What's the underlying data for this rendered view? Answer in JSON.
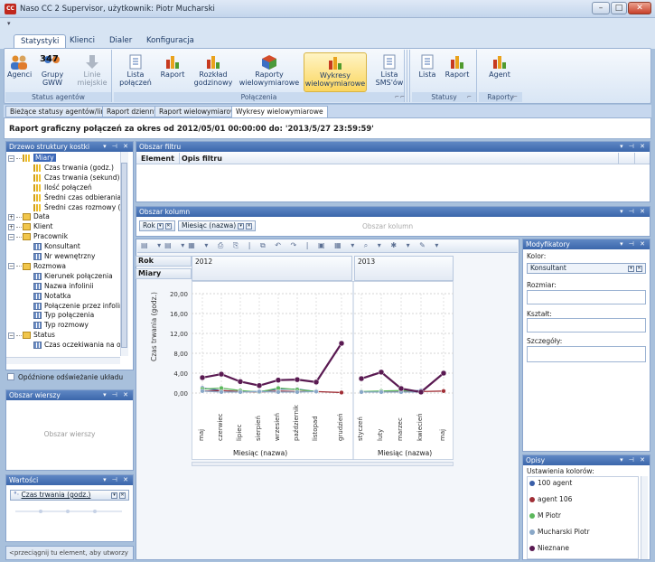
{
  "window": {
    "title": "Naso CC 2 Supervisor, użytkownik: Piotr Mucharski",
    "icon_label": "CC"
  },
  "ribbon_tabs": [
    "Statystyki",
    "Klienci",
    "Dialer",
    "Konfiguracja"
  ],
  "ribbon": {
    "groups": [
      {
        "label": "Status agentów",
        "buttons": [
          "Agenci",
          "Grupy GWW",
          "Linie miejskie"
        ]
      },
      {
        "label": "Połączenia",
        "buttons": [
          "Lista połączeń",
          "Raport",
          "Rozkład godzinowy",
          "Raporty wielowymiarowe",
          "Wykresy wielowymiarowe"
        ]
      },
      {
        "label": "",
        "buttons": [
          "Lista SMS'ów"
        ]
      },
      {
        "label": "Statusy",
        "buttons": [
          "Lista",
          "Raport"
        ]
      },
      {
        "label": "Raporty",
        "buttons": [
          "Agent"
        ]
      }
    ],
    "badge_value": "347"
  },
  "doc_tabs": [
    "Bieżące statusy agentów/linii",
    "Raport dzienny",
    "Raport wielowymiarowe",
    "Wykresy wielowymiarowe"
  ],
  "report_title": "Raport graficzny połączeń za okres od 2012/05/01 00:00:00 do: '2013/5/27 23:59:59'",
  "tree_pane": {
    "title": "Drzewo struktury kostki",
    "items": [
      {
        "label": "Miary",
        "level": 0,
        "icon": "measures-icon",
        "expanded": true,
        "selected": true
      },
      {
        "label": "Czas trwania (godz.)",
        "level": 2,
        "icon": "measure-icon"
      },
      {
        "label": "Czas trwania (sekund)",
        "level": 2,
        "icon": "measure-icon"
      },
      {
        "label": "Ilość połączeń",
        "level": 2,
        "icon": "measure-icon"
      },
      {
        "label": "Średni czas odbierania",
        "level": 2,
        "icon": "measure-icon"
      },
      {
        "label": "Średni czas rozmowy (se",
        "level": 2,
        "icon": "measure-icon"
      },
      {
        "label": "Data",
        "level": 0,
        "icon": "dimension-icon",
        "expanded": false
      },
      {
        "label": "Klient",
        "level": 0,
        "icon": "dimension-icon",
        "expanded": false
      },
      {
        "label": "Pracownik",
        "level": 0,
        "icon": "dimension-icon",
        "expanded": true
      },
      {
        "label": "Konsultant",
        "level": 2,
        "icon": "attribute-icon"
      },
      {
        "label": "Nr wewnętrzny",
        "level": 2,
        "icon": "attribute-icon"
      },
      {
        "label": "Rozmowa",
        "level": 0,
        "icon": "dimension-icon",
        "expanded": true
      },
      {
        "label": "Kierunek połączenia",
        "level": 2,
        "icon": "attribute-icon"
      },
      {
        "label": "Nazwa infolinii",
        "level": 2,
        "icon": "attribute-icon"
      },
      {
        "label": "Notatka",
        "level": 2,
        "icon": "attribute-icon"
      },
      {
        "label": "Połączenie przez infolin",
        "level": 2,
        "icon": "attribute-icon"
      },
      {
        "label": "Typ połączenia",
        "level": 2,
        "icon": "attribute-icon"
      },
      {
        "label": "Typ rozmowy",
        "level": 2,
        "icon": "attribute-icon"
      },
      {
        "label": "Status",
        "level": 0,
        "icon": "dimension-icon",
        "expanded": true
      },
      {
        "label": "Czas oczekiwania na oc",
        "level": 2,
        "icon": "attribute-icon"
      }
    ],
    "deferred_update": "Opóźnione odświeżanie układu"
  },
  "rows_pane": {
    "title": "Obszar wierszy",
    "placeholder": "Obszar wierszy"
  },
  "values_pane": {
    "title": "Wartości",
    "field": "Czas trwania (godz.)"
  },
  "drag_hint": "<przeciągnij tu element, aby utworzy",
  "filter_pane": {
    "title": "Obszar filtru",
    "col_element": "Element",
    "col_desc": "Opis filtru"
  },
  "columns_pane": {
    "title": "Obszar kolumn",
    "chips": [
      "Rok",
      "Miesiąc (nazwa)"
    ],
    "placeholder": "Obszar kolumn"
  },
  "chart_area": {
    "row_headers": [
      "Rok",
      "Miary"
    ],
    "years": [
      "2012",
      "2013"
    ],
    "ylabel": "Czas trwania (godz.)",
    "xlabel_groups": [
      "Miesiąc (nazwa)",
      "Miesiąc (nazwa)"
    ]
  },
  "chart_data": {
    "type": "line",
    "categories": [
      "maj",
      "czerwiec",
      "lipiec",
      "sierpień",
      "wrzesień",
      "październik",
      "listopad",
      "grudzień",
      "styczeń",
      "luty",
      "marzec",
      "kwiecień",
      "maj"
    ],
    "year_groups": [
      {
        "year": "2012",
        "count": 8
      },
      {
        "year": "2013",
        "count": 5
      }
    ],
    "ylabel": "Czas trwania (godz.)",
    "xlabel": "Miesiąc (nazwa)",
    "ylim": [
      0,
      22
    ],
    "yticks": [
      "0,00",
      "4,00",
      "8,00",
      "12,00",
      "16,00",
      "20,00"
    ],
    "series": [
      {
        "name": "100 agent",
        "color": "#3a5fa8",
        "values": [
          1.0,
          0.5,
          0.3,
          0.3,
          0.8,
          0.8,
          0.3,
          null,
          0.2,
          0.3,
          0.4,
          0.5,
          null
        ]
      },
      {
        "name": "agent 106",
        "color": "#a02e36",
        "values": [
          0.4,
          0.5,
          0.3,
          0.2,
          0.4,
          0.3,
          0.3,
          0.1,
          0.2,
          0.3,
          0.2,
          0.3,
          0.4
        ]
      },
      {
        "name": "M Piotr",
        "color": "#5cb85c",
        "values": [
          0.8,
          1.0,
          0.5,
          0.2,
          1.0,
          0.7,
          0.3,
          null,
          0.3,
          0.4,
          0.5,
          0.3,
          null
        ]
      },
      {
        "name": "Mucharski Piotr",
        "color": "#8aa8c8",
        "values": [
          0.4,
          0.2,
          0.2,
          0.3,
          0.2,
          0.2,
          0.3,
          null,
          0.2,
          0.2,
          0.2,
          0.2,
          null
        ]
      },
      {
        "name": "Nieznane",
        "color": "#5a1a52",
        "values": [
          3.1,
          3.8,
          2.3,
          1.5,
          2.6,
          2.7,
          2.2,
          10.0,
          2.9,
          4.2,
          0.9,
          0.2,
          4.0
        ]
      }
    ],
    "legend_title": "Ustawienia kolorów:"
  },
  "modifiers_pane": {
    "title": "Modyfikatory",
    "color_label": "Kolor:",
    "color_value": "Konsultant",
    "size_label": "Rozmiar:",
    "shape_label": "Kształt:",
    "detail_label": "Szczegóły:"
  },
  "legend_pane": {
    "title": "Opisy",
    "heading": "Ustawienia kolorów:"
  }
}
